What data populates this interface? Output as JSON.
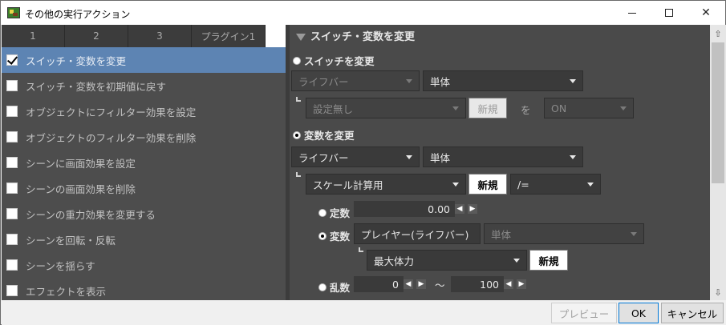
{
  "window": {
    "title": "その他の実行アクション"
  },
  "tabs": [
    "1",
    "2",
    "3",
    "プラグイン1"
  ],
  "action_list": [
    {
      "label": "スイッチ・変数を変更",
      "checked": true,
      "selected": true
    },
    {
      "label": "スイッチ・変数を初期値に戻す",
      "checked": false
    },
    {
      "label": "オブジェクトにフィルター効果を設定",
      "checked": false
    },
    {
      "label": "オブジェクトのフィルター効果を削除",
      "checked": false
    },
    {
      "label": "シーンに画面効果を設定",
      "checked": false
    },
    {
      "label": "シーンの画面効果を削除",
      "checked": false
    },
    {
      "label": "シーンの重力効果を変更する",
      "checked": false
    },
    {
      "label": "シーンを回転・反転",
      "checked": false
    },
    {
      "label": "シーンを揺らす",
      "checked": false
    },
    {
      "label": "エフェクトを表示",
      "checked": false
    }
  ],
  "panel": {
    "header": "スイッチ・変数を変更",
    "switch_radio": "スイッチを変更",
    "switch_target": "ライフバー",
    "switch_scope": "単体",
    "switch_setting": "設定無し",
    "switch_new": "新規",
    "switch_to": "を",
    "switch_value": "ON",
    "var_radio": "変数を変更",
    "var_target": "ライフバー",
    "var_scope": "単体",
    "var_name": "スケール計算用",
    "var_new": "新規",
    "var_op": "/=",
    "const_label": "定数",
    "const_value": "0.00",
    "variable_label": "変数",
    "variable_target": "プレイヤー(ライフバー)",
    "variable_scope": "単体",
    "variable_name": "最大体力",
    "variable_new": "新規",
    "random_label": "乱数",
    "random_min": "0",
    "random_sep": "〜",
    "random_max": "100"
  },
  "footer": {
    "preview": "プレビュー",
    "ok": "OK",
    "cancel": "キャンセル"
  }
}
